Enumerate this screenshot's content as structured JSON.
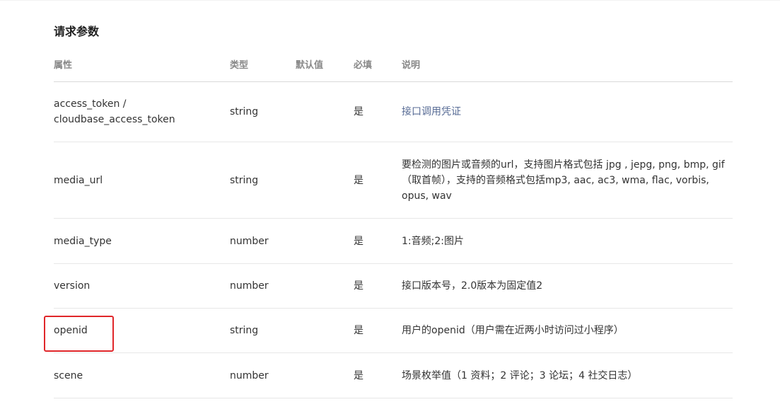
{
  "section": {
    "title": "请求参数"
  },
  "table": {
    "headers": {
      "name": "属性",
      "type": "类型",
      "default": "默认值",
      "required": "必填",
      "description": "说明"
    },
    "rows": [
      {
        "name_line1": "access_token /",
        "name_line2": "cloudbase_access_token",
        "type": "string",
        "default": "",
        "required": "是",
        "description": "接口调用凭证"
      },
      {
        "name": "media_url",
        "type": "string",
        "default": "",
        "required": "是",
        "description": "要检测的图片或音频的url，支持图片格式包括 jpg , jepg, png, bmp, gif （取首帧），支持的音频格式包括mp3, aac, ac3, wma, flac, vorbis, opus, wav"
      },
      {
        "name": "media_type",
        "type": "number",
        "default": "",
        "required": "是",
        "description": "1:音频;2:图片"
      },
      {
        "name": "version",
        "type": "number",
        "default": "",
        "required": "是",
        "description": "接口版本号，2.0版本为固定值2"
      },
      {
        "name": "openid",
        "type": "string",
        "default": "",
        "required": "是",
        "description": "用户的openid（用户需在近两小时访问过小程序）"
      },
      {
        "name": "scene",
        "type": "number",
        "default": "",
        "required": "是",
        "description": "场景枚举值（1 资料；2 评论；3 论坛；4 社交日志）"
      }
    ]
  },
  "colors": {
    "link": "#576b95",
    "highlight": "#e0262a",
    "divider": "#e7e7e7"
  }
}
